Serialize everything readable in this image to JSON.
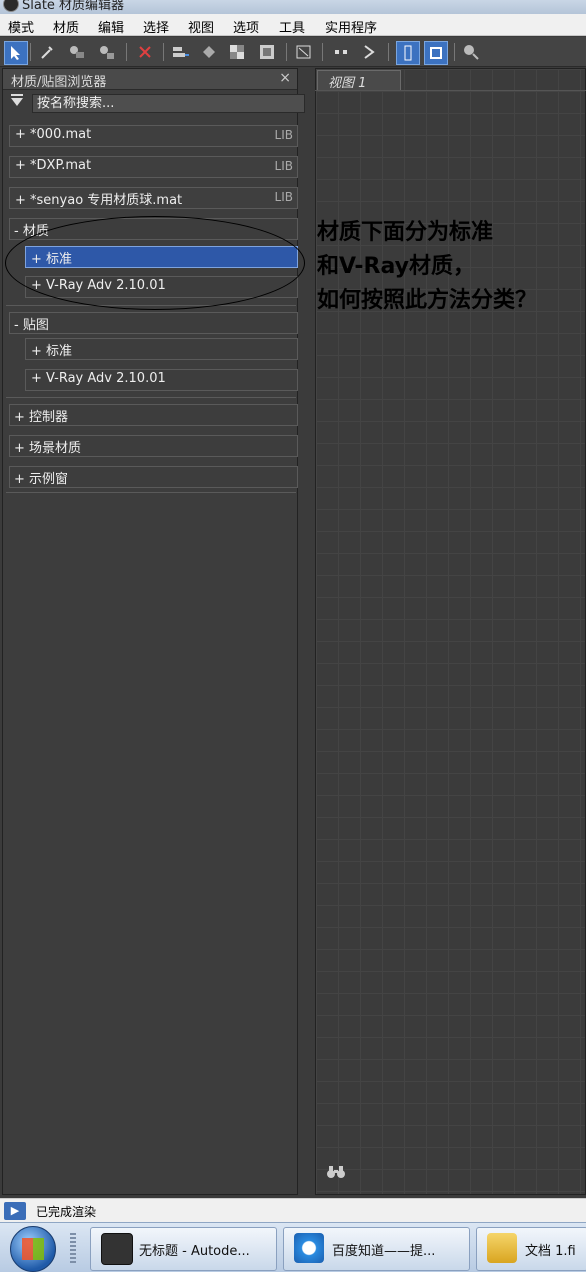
{
  "window": {
    "title": "Slate 材质编辑器"
  },
  "menu": [
    "模式",
    "材质",
    "编辑",
    "选择",
    "视图",
    "选项",
    "工具",
    "实用程序"
  ],
  "toolbar_icons": [
    "select-arrow-icon",
    "eyedropper-icon",
    "put-to-scene-icon",
    "assign-to-selection-icon",
    "delete-icon",
    "move-children-icon",
    "select-material-icon",
    "checker-icon",
    "background-icon",
    "lay-out-icon",
    "nodes-icon",
    "hide-icon",
    "layout-left-icon",
    "layout-top-icon",
    "zoom-icon"
  ],
  "browser": {
    "title": "材质/贴图浏览器",
    "close": "×",
    "search_placeholder": "按名称搜索...",
    "libraries": [
      {
        "label": "+ *000.mat",
        "tag": "LIB"
      },
      {
        "label": "+ *DXP.mat",
        "tag": "LIB"
      },
      {
        "label": "+ *senyao 专用材质球.mat",
        "tag": "LIB"
      }
    ],
    "materials": {
      "label": "- 材质",
      "items": [
        "+ 标准",
        "+ V-Ray Adv 2.10.01"
      ]
    },
    "maps": {
      "label": "- 贴图",
      "items": [
        "+ 标准",
        "+ V-Ray Adv 2.10.01"
      ]
    },
    "others": [
      "+ 控制器",
      "+ 场景材质",
      "+ 示例窗"
    ]
  },
  "view": {
    "tab": "视图 1"
  },
  "annotation": {
    "lines": [
      "材质下面分为标准",
      "和V-Ray材质，",
      "如何按照此方法分类？"
    ]
  },
  "status": {
    "text": "已完成渲染"
  },
  "taskbar": {
    "tasks": [
      {
        "label": "无标题 - Autode..."
      },
      {
        "label": "百度知道——提..."
      },
      {
        "label": "文档 1.fi"
      }
    ]
  },
  "colors": {
    "selection": "#2e58a8",
    "panel": "#3d3d3d",
    "accent": "#3c72c0"
  }
}
